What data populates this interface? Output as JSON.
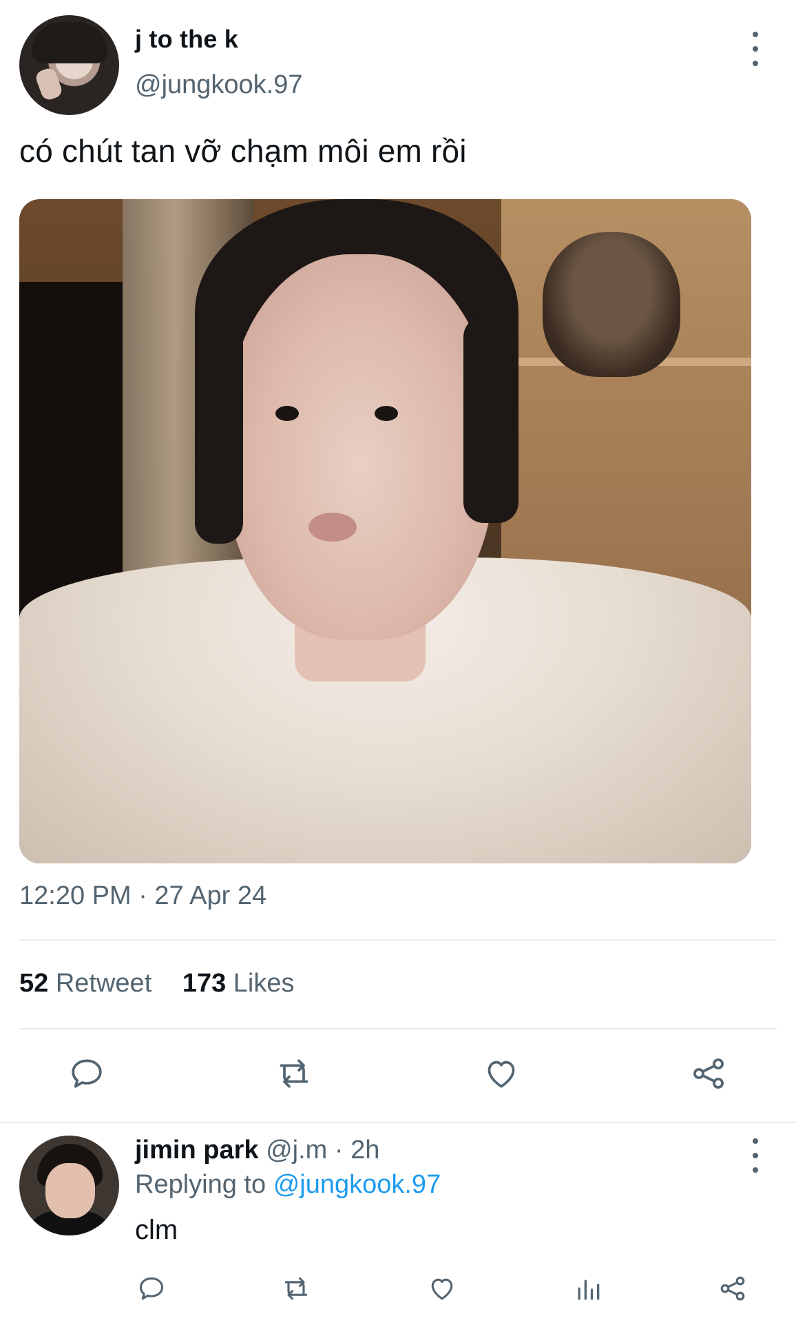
{
  "tweet": {
    "author_name": "j to the k",
    "author_handle": "@jungkook.97",
    "text": "có chút tan vỡ chạm môi em rồi",
    "timestamp": "12:20 PM · 27 Apr 24",
    "retweet_count": "52",
    "retweet_label": "Retweet",
    "like_count": "173",
    "like_label": "Likes"
  },
  "actions": {
    "icons": [
      "reply-icon",
      "retweet-icon",
      "like-icon",
      "share-icon"
    ]
  },
  "reply": {
    "author_name": "jimin park",
    "author_handle": "@j.m",
    "age": "· 2h",
    "replying_prefix": "Replying to",
    "replying_to": "@jungkook.97",
    "text": "clm",
    "icons": [
      "reply-icon",
      "retweet-icon",
      "like-icon",
      "analytics-icon",
      "share-icon"
    ]
  },
  "colors": {
    "text_primary": "#0f1419",
    "text_secondary": "#536471",
    "link": "#1d9bf0",
    "divider": "#e7ecef"
  }
}
